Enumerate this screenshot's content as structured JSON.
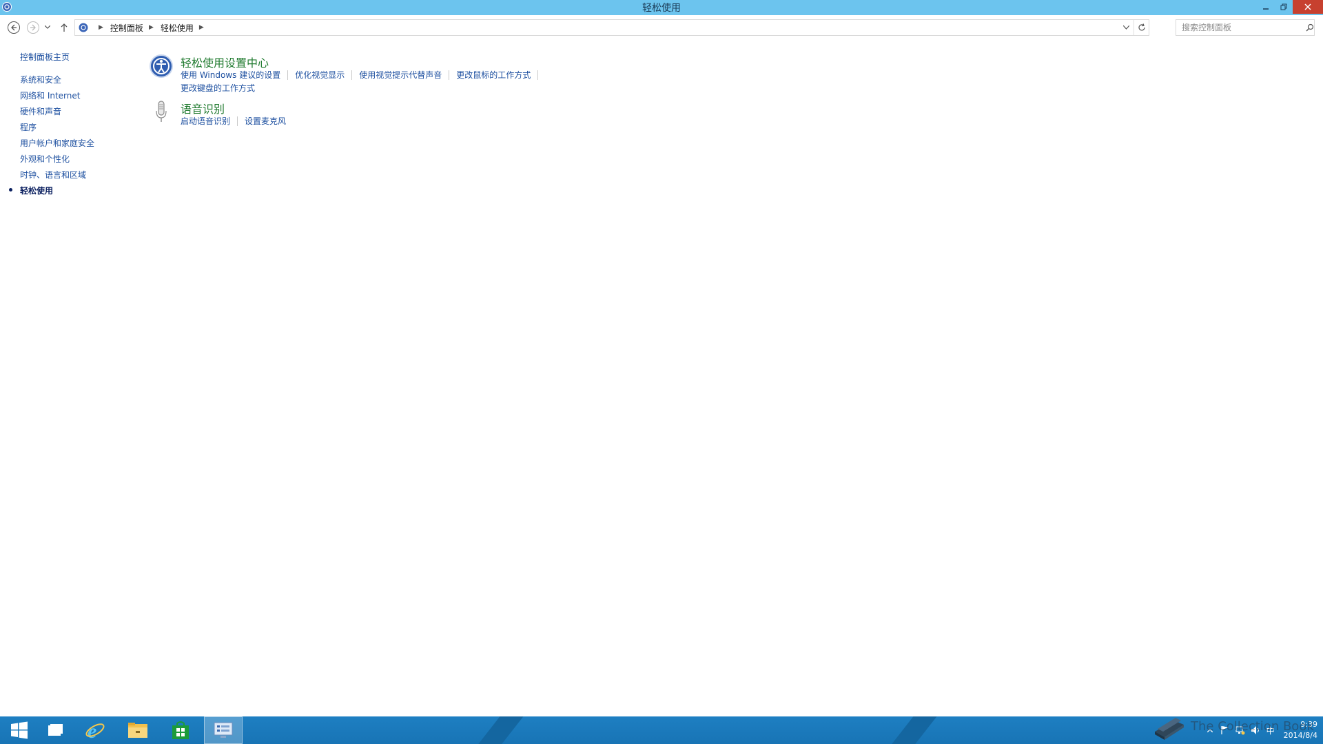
{
  "window": {
    "title": "轻松使用"
  },
  "colors": {
    "titlebar": "#6cc4ee",
    "link": "#1e50a0",
    "section_title": "#1f7a2e",
    "taskbar": "#1e7fc2",
    "close": "#c7402f"
  },
  "address": {
    "crumbs": [
      "控制面板",
      "轻松使用"
    ]
  },
  "search": {
    "placeholder": "搜索控制面板"
  },
  "sidebar": {
    "home": "控制面板主页",
    "items": [
      {
        "label": "系统和安全"
      },
      {
        "label": "网络和 Internet"
      },
      {
        "label": "硬件和声音"
      },
      {
        "label": "程序"
      },
      {
        "label": "用户帐户和家庭安全"
      },
      {
        "label": "外观和个性化"
      },
      {
        "label": "时钟、语言和区域"
      },
      {
        "label": "轻松使用",
        "current": true
      }
    ]
  },
  "sections": [
    {
      "title": "轻松使用设置中心",
      "icon": "ease-of-access-icon",
      "links": [
        "使用 Windows 建议的设置",
        "优化视觉显示",
        "使用视觉提示代替声音",
        "更改鼠标的工作方式"
      ],
      "links2": [
        "更改键盘的工作方式"
      ]
    },
    {
      "title": "语音识别",
      "icon": "microphone-icon",
      "links": [
        "启动语音识别",
        "设置麦克风"
      ]
    }
  ],
  "taskbar": {
    "clock_time": "9:39",
    "clock_date": "2014/8/4",
    "ime": "中",
    "watermark": "The Collection Book"
  }
}
